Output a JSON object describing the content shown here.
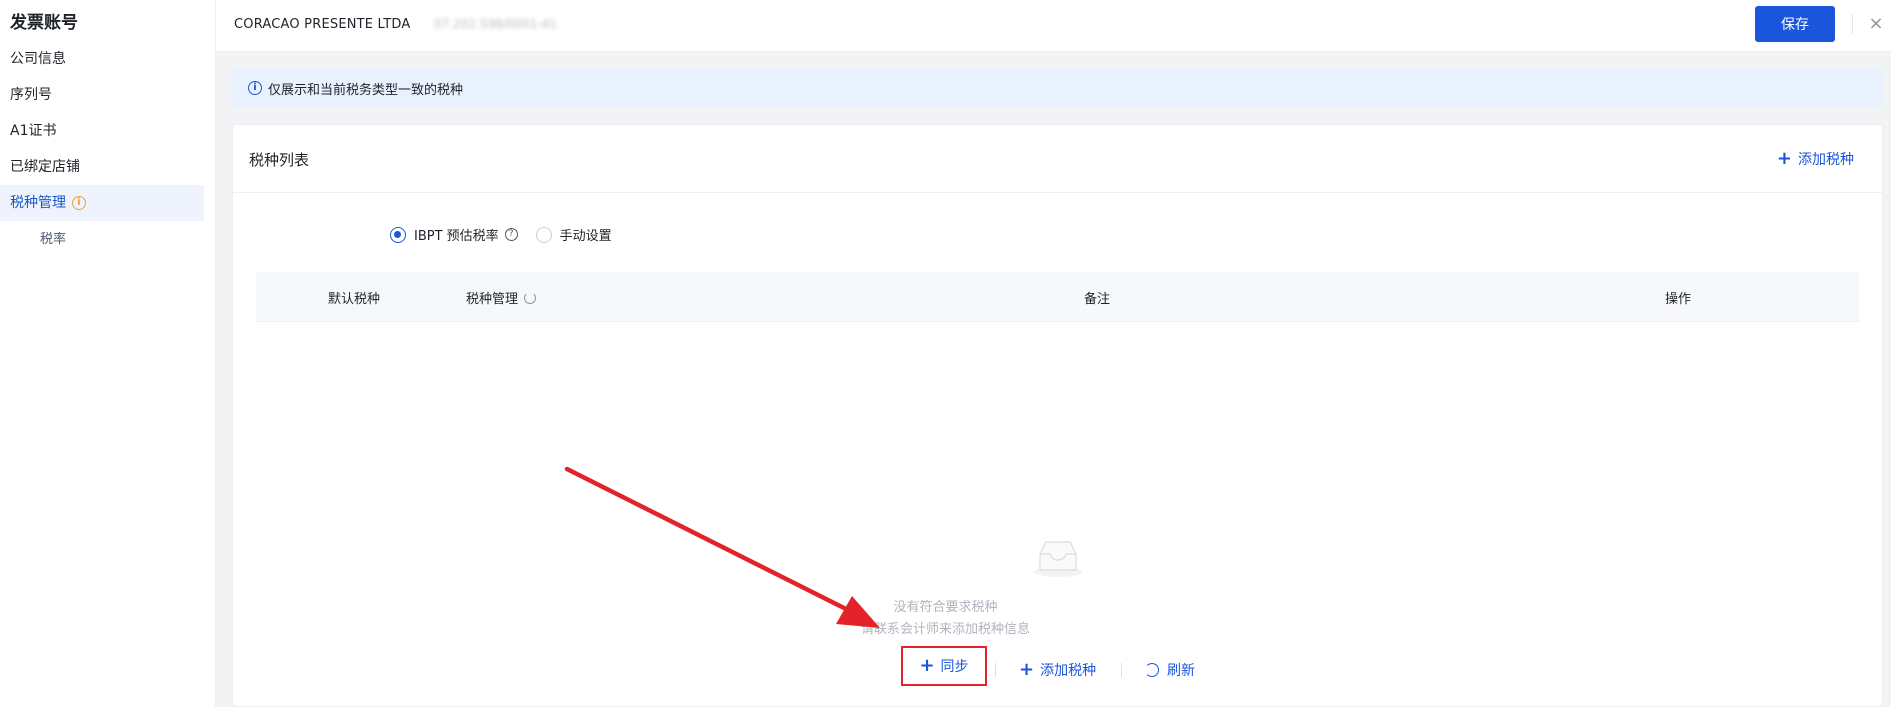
{
  "sidebar": {
    "title": "发票账号",
    "items": [
      {
        "label": "公司信息"
      },
      {
        "label": "序列号"
      },
      {
        "label": "A1证书"
      },
      {
        "label": "已绑定店铺"
      },
      {
        "label": "税种管理",
        "active": true,
        "badge_icon": "warning-icon"
      }
    ]
  },
  "header": {
    "company_name": "CORACAO PRESENTE LTDA",
    "company_id": "07.202.598/0001-41",
    "save_label": "保存",
    "close_glyph": "×"
  },
  "notice": {
    "text": "仅展示和当前税务类型一致的税种",
    "icon": "info-icon"
  },
  "card": {
    "title": "税种列表",
    "add_label": "添加税种",
    "rate": {
      "label": "税率",
      "options": [
        {
          "label": "IBPT 预估税率",
          "checked": true
        },
        {
          "label": "手动设置",
          "checked": false
        }
      ]
    },
    "table": {
      "columns": [
        "默认税种",
        "税种管理",
        "备注",
        "操作"
      ],
      "rows": []
    },
    "empty": {
      "line1": "没有符合要求税种",
      "line2": "请联系会计师来添加税种信息"
    },
    "actions": {
      "sync": "同步",
      "add": "添加税种",
      "refresh": "刷新"
    }
  },
  "colors": {
    "primary": "#1a56db",
    "annotation_red": "#e3222a",
    "notice_bg": "#e8f1fd",
    "active_sidebar_bg": "#eef3fd"
  }
}
